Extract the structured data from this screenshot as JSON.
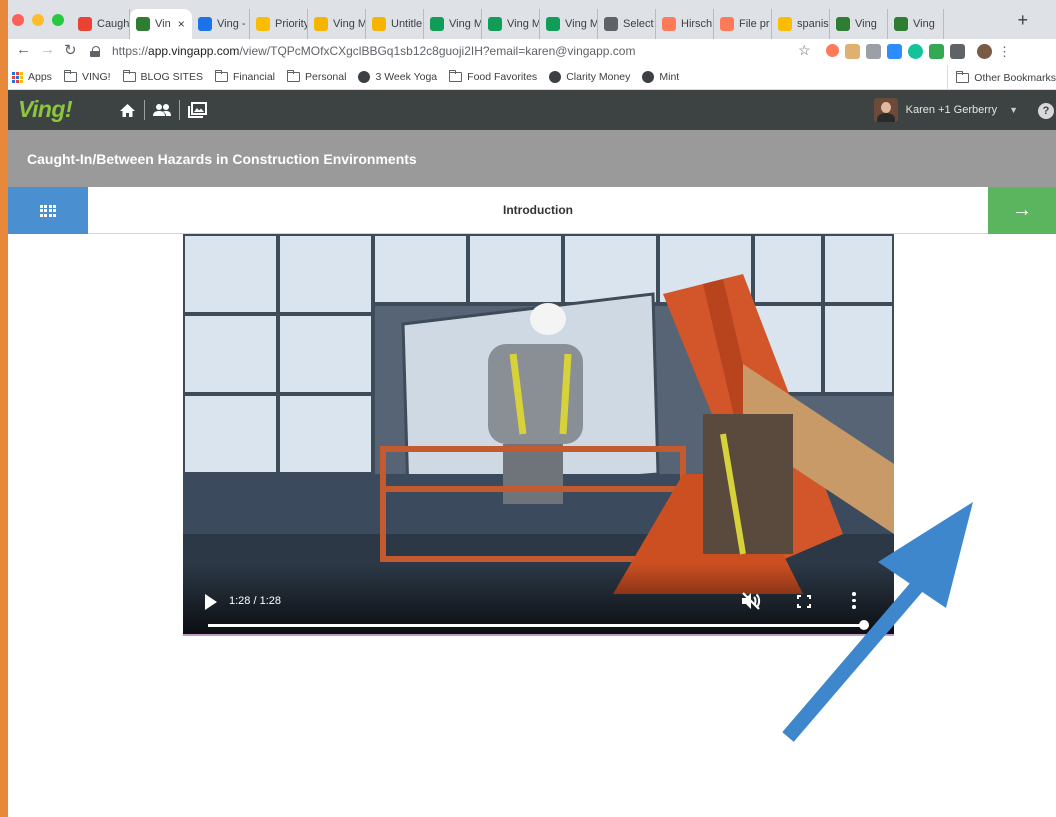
{
  "browser": {
    "tabs": [
      {
        "title": "Caugh",
        "icon": "gmail-icon",
        "color": "#ea4335"
      },
      {
        "title": "Vin",
        "icon": "ving-icon",
        "color": "#2e7d32",
        "active": true
      },
      {
        "title": "Ving -",
        "icon": "calendar-icon",
        "color": "#1a73e8"
      },
      {
        "title": "Priority",
        "icon": "google-drive-icon",
        "color": "#fbbc04"
      },
      {
        "title": "Ving M",
        "icon": "google-slides-icon",
        "color": "#f4b400"
      },
      {
        "title": "Untitle",
        "icon": "google-slides-icon",
        "color": "#f4b400"
      },
      {
        "title": "Ving M",
        "icon": "google-sheets-icon",
        "color": "#0f9d58"
      },
      {
        "title": "Ving M",
        "icon": "google-sheets-icon",
        "color": "#0f9d58"
      },
      {
        "title": "Ving M",
        "icon": "google-sheets-icon",
        "color": "#0f9d58"
      },
      {
        "title": "Select",
        "icon": "ving-icon",
        "color": "#5f6368"
      },
      {
        "title": "Hirsch",
        "icon": "hubspot-icon",
        "color": "#ff7a59"
      },
      {
        "title": "File pr",
        "icon": "hubspot-icon",
        "color": "#ff7a59"
      },
      {
        "title": "spanis",
        "icon": "google-drive-icon",
        "color": "#fbbc04"
      },
      {
        "title": "Ving",
        "icon": "ving-icon",
        "color": "#2e7d32"
      },
      {
        "title": "Ving",
        "icon": "ving-icon",
        "color": "#2e7d32"
      }
    ],
    "new_tab": "+",
    "url_prefix": "https://",
    "url_host": "app.vingapp.com",
    "url_path": "/view/TQPcMOfxCXgclBBGq1sb12c8guoji2IH?email=karen@vingapp.com",
    "bookmarks": [
      {
        "label": "Apps",
        "icon": "apps-grid-icon"
      },
      {
        "label": "VING!",
        "icon": "folder-icon"
      },
      {
        "label": "BLOG SITES",
        "icon": "folder-icon"
      },
      {
        "label": "Financial",
        "icon": "folder-icon"
      },
      {
        "label": "Personal",
        "icon": "folder-icon"
      },
      {
        "label": "3 Week Yoga",
        "icon": "globe-icon"
      },
      {
        "label": "Food Favorites",
        "icon": "folder-icon"
      },
      {
        "label": "Clarity Money",
        "icon": "globe-icon"
      },
      {
        "label": "Mint",
        "icon": "globe-icon"
      }
    ],
    "other_bookmarks": "Other Bookmarks"
  },
  "app": {
    "logo": "Ving!",
    "user_name": "Karen +1 Gerberry",
    "help_label": "?",
    "course_title": "Caught-In/Between Hazards in Construction Environments",
    "section_title": "Introduction",
    "next_arrow": "→"
  },
  "video": {
    "timecode": "1:28 / 1:28",
    "progress": 1.0
  },
  "colors": {
    "accent_green": "#8cc63f",
    "menu_blue": "#4a8fd0",
    "next_green": "#5ab55e",
    "annotation_arrow": "#3f87cc"
  }
}
